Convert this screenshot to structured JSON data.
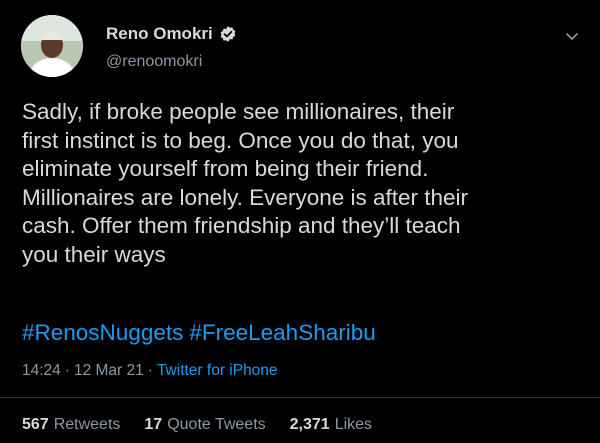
{
  "author": {
    "name": "Reno Omokri",
    "handle": "@renoomokri"
  },
  "tweet": {
    "text": "Sadly, if broke people see millionaires, their\nfirst instinct is to beg. Once you do that, you\neliminate yourself from being their friend.\nMillionaires are lonely. Everyone is after their\ncash. Offer them friendship and they’ll teach\nyou their ways",
    "hashtags": [
      "#RenosNuggets",
      "#FreeLeahSharibu"
    ],
    "time": "14:24",
    "date": "12 Mar 21",
    "source": "Twitter for iPhone"
  },
  "stats": {
    "retweets_count": "567",
    "retweets_label": "Retweets",
    "quote_tweets_count": "17",
    "quote_tweets_label": "Quote Tweets",
    "likes_count": "2,371",
    "likes_label": "Likes"
  },
  "colors": {
    "background": "#000000",
    "text": "#d9d9d9",
    "secondary": "#8b98a5",
    "accent": "#1d9bf0"
  },
  "icons": {
    "verified": "verified-badge-icon",
    "menu": "chevron-down-icon"
  }
}
